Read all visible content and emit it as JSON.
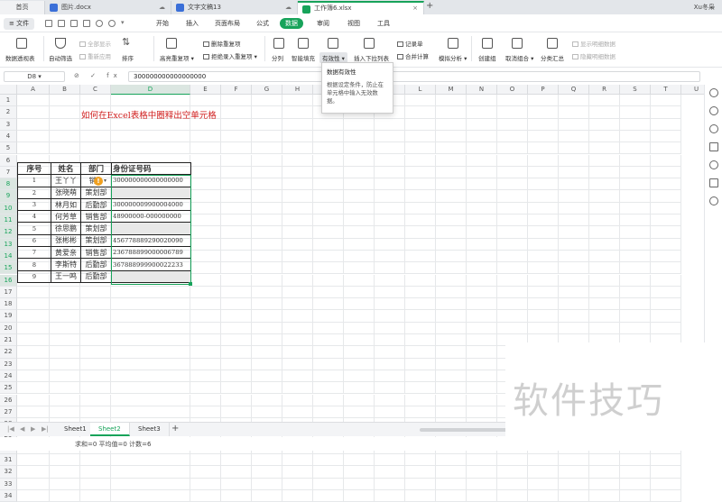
{
  "tabs": {
    "home": "首页",
    "items": [
      {
        "label": "图片.docx",
        "color": "#3a6fd8"
      },
      {
        "label": "文字文稿13",
        "color": "#3a6fd8"
      },
      {
        "label": "工作簿6.xlsx",
        "color": "#17a35a"
      }
    ],
    "user": "Xu冬枭"
  },
  "menu": {
    "file": "文件",
    "items": [
      "开始",
      "插入",
      "页面布局",
      "公式",
      "数据",
      "审阅",
      "视图",
      "工具"
    ],
    "active_index": 4
  },
  "ribbon": {
    "pivot": "数据透视表",
    "autofilter": "自动筛选",
    "show_all": "全部显示",
    "reapply": "重新应用",
    "sort": "排序",
    "highlight_dup": "高亮重复项",
    "remove_dup": "删除重复项",
    "reject_dup": "拒绝录入重复项",
    "split": "分列",
    "smart_fill": "智能填充",
    "validity": "有效性",
    "dropdown": "插入下拉列表",
    "form": "记录单",
    "merge_calc": "合并计算",
    "simulate": "模拟分析",
    "group": "创建组",
    "ungroup": "取消组合",
    "subtotal": "分类汇总",
    "show_detail": "显示明细数据",
    "hide_detail": "隐藏明细数据"
  },
  "tooltip": {
    "title": "数据有效性",
    "desc": "根据设定条件，防止在单元格中输入无效数据。"
  },
  "formula": {
    "cell_ref": "D8",
    "icons": "⊘ ✓ fx",
    "value": "300000000000000000"
  },
  "sheet": {
    "columns": [
      "A",
      "B",
      "C",
      "D",
      "E",
      "F",
      "G",
      "H",
      "I",
      "J",
      "K",
      "L",
      "M",
      "N",
      "O",
      "P",
      "Q",
      "R",
      "S",
      "T",
      "U"
    ],
    "rows": [
      "1",
      "2",
      "3",
      "4",
      "5",
      "6",
      "7",
      "8",
      "9",
      "10",
      "11",
      "12",
      "13",
      "14",
      "15",
      "16",
      "17",
      "18",
      "19",
      "20",
      "21",
      "22",
      "23",
      "24",
      "25",
      "26",
      "27",
      "28",
      "29",
      "30",
      "31",
      "32",
      "33",
      "34"
    ],
    "title": "如何在Excel表格中圈释出空单元格",
    "table_header": [
      "序号",
      "姓名",
      "部门",
      "身份证号码"
    ],
    "table_rows": [
      [
        "1",
        "王丫丫",
        "销...",
        "300000000000000000"
      ],
      [
        "2",
        "张晓萌",
        "策划部",
        ""
      ],
      [
        "3",
        "林月如",
        "后勤部",
        "300000009900004000"
      ],
      [
        "4",
        "何芳草",
        "销售部",
        "48900000-000000000"
      ],
      [
        "5",
        "徐思鹏",
        "策划部",
        ""
      ],
      [
        "6",
        "张彬彬",
        "策划部",
        "456778889290020090"
      ],
      [
        "7",
        "黄爱亲",
        "销售部",
        "236788899000006789"
      ],
      [
        "8",
        "李斯特",
        "后勤部",
        "367888999900022233"
      ],
      [
        "9",
        "王一鸣",
        "后勤部",
        ""
      ]
    ]
  },
  "sheets": [
    "Sheet1",
    "Sheet2",
    "Sheet3"
  ],
  "active_sheet": "Sheet2",
  "status": "求和=0  平均值=0  计数=6",
  "watermark": "软件技巧"
}
